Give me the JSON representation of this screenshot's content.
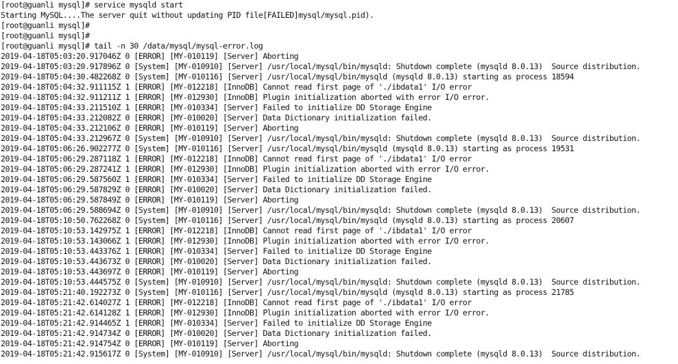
{
  "terminal": {
    "lines": [
      "[root@guanli mysql]# service mysqld start",
      "Starting MySQL....The server quit without updating PID file[FAILED]mysql/mysql.pid).",
      "[root@guanli mysql]#",
      "[root@guanli mysql]#",
      "[root@guanli mysql]# tail -n 30 /data/mysql/mysql-error.log",
      "2019-04-18T05:03:20.917046Z 0 [ERROR] [MY-010119] [Server] Aborting",
      "2019-04-18T05:03:20.917896Z 0 [System] [MY-010910] [Server] /usr/local/mysql/bin/mysqld: Shutdown complete (mysqld 8.0.13)  Source distribution.",
      "2019-04-18T05:04:30.482268Z 0 [System] [MY-010116] [Server] /usr/local/mysql/bin/mysqld (mysqld 8.0.13) starting as process 18594",
      "2019-04-18T05:04:32.911115Z 1 [ERROR] [MY-012218] [InnoDB] Cannot read first page of './ibdata1' I/O error",
      "2019-04-18T05:04:32.911211Z 1 [ERROR] [MY-012930] [InnoDB] Plugin initialization aborted with error I/O error.",
      "2019-04-18T05:04:33.211510Z 1 [ERROR] [MY-010334] [Server] Failed to initialize DD Storage Engine",
      "2019-04-18T05:04:33.212082Z 0 [ERROR] [MY-010020] [Server] Data Dictionary initialization failed.",
      "2019-04-18T05:04:33.212106Z 0 [ERROR] [MY-010119] [Server] Aborting",
      "2019-04-18T05:04:33.212967Z 0 [System] [MY-010910] [Server] /usr/local/mysql/bin/mysqld: Shutdown complete (mysqld 8.0.13)  Source distribution.",
      "2019-04-18T05:06:26.902277Z 0 [System] [MY-010116] [Server] /usr/local/mysql/bin/mysqld (mysqld 8.0.13) starting as process 19531",
      "2019-04-18T05:06:29.287118Z 1 [ERROR] [MY-012218] [InnoDB] Cannot read first page of './ibdata1' I/O error",
      "2019-04-18T05:06:29.287241Z 1 [ERROR] [MY-012930] [InnoDB] Plugin initialization aborted with error I/O error.",
      "2019-04-18T05:06:29.587560Z 1 [ERROR] [MY-010334] [Server] Failed to initialize DD Storage Engine",
      "2019-04-18T05:06:29.587829Z 0 [ERROR] [MY-010020] [Server] Data Dictionary initialization failed.",
      "2019-04-18T05:06:29.587849Z 0 [ERROR] [MY-010119] [Server] Aborting",
      "2019-04-18T05:06:29.588694Z 0 [System] [MY-010910] [Server] /usr/local/mysql/bin/mysqld: Shutdown complete (mysqld 8.0.13)  Source distribution.",
      "2019-04-18T05:10:50.762268Z 0 [System] [MY-010116] [Server] /usr/local/mysql/bin/mysqld (mysqld 8.0.13) starting as process 20607",
      "2019-04-18T05:10:53.142975Z 1 [ERROR] [MY-012218] [InnoDB] Cannot read first page of './ibdata1' I/O error",
      "2019-04-18T05:10:53.143066Z 1 [ERROR] [MY-012930] [InnoDB] Plugin initialization aborted with error I/O error.",
      "2019-04-18T05:10:53.443376Z 1 [ERROR] [MY-010334] [Server] Failed to initialize DD Storage Engine",
      "2019-04-18T05:10:53.443673Z 0 [ERROR] [MY-010020] [Server] Data Dictionary initialization failed.",
      "2019-04-18T05:10:53.443697Z 0 [ERROR] [MY-010119] [Server] Aborting",
      "2019-04-18T05:10:53.444575Z 0 [System] [MY-010910] [Server] /usr/local/mysql/bin/mysqld: Shutdown complete (mysqld 8.0.13)  Source distribution.",
      "2019-04-18T05:21:40.192273Z 0 [System] [MY-010116] [Server] /usr/local/mysql/bin/mysqld (mysqld 8.0.13) starting as process 21785",
      "2019-04-18T05:21:42.614027Z 1 [ERROR] [MY-012218] [InnoDB] Cannot read first page of './ibdata1' I/O error",
      "2019-04-18T05:21:42.614128Z 1 [ERROR] [MY-012930] [InnoDB] Plugin initialization aborted with error I/O error.",
      "2019-04-18T05:21:42.914465Z 1 [ERROR] [MY-010334] [Server] Failed to initialize DD Storage Engine",
      "2019-04-18T05:21:42.914734Z 0 [ERROR] [MY-010020] [Server] Data Dictionary initialization failed.",
      "2019-04-18T05:21:42.914754Z 0 [ERROR] [MY-010119] [Server] Aborting",
      "2019-04-18T05:21:42.915617Z 0 [System] [MY-010910] [Server] /usr/local/mysql/bin/mysqld: Shutdown complete (mysqld 8.0.13)  Source distribution."
    ]
  }
}
